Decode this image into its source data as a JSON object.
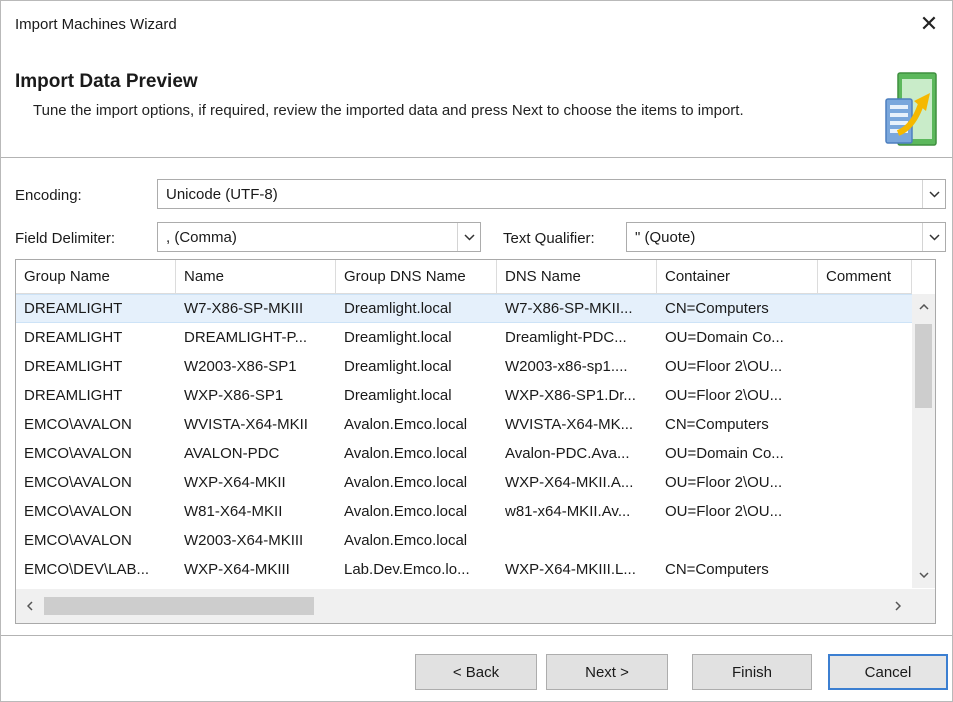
{
  "window": {
    "title": "Import Machines Wizard",
    "close_glyph": "✕"
  },
  "header": {
    "title": "Import Data Preview",
    "description": "Tune the import options, if required, review the imported data and press Next to choose the items to import.",
    "icon": "import-data-icon"
  },
  "encoding": {
    "label": "Encoding:",
    "value": "Unicode (UTF-8)"
  },
  "delimiter": {
    "label": "Field Delimiter:",
    "value": ", (Comma)"
  },
  "qualifier": {
    "label": "Text Qualifier:",
    "value": "\" (Quote)"
  },
  "grid": {
    "columns": [
      "Group Name",
      "Name",
      "Group DNS Name",
      "DNS Name",
      "Container",
      "Comment"
    ],
    "rows": [
      [
        "DREAMLIGHT",
        "W7-X86-SP-MKIII",
        "Dreamlight.local",
        "W7-X86-SP-MKII...",
        "CN=Computers",
        ""
      ],
      [
        "DREAMLIGHT",
        "DREAMLIGHT-P...",
        "Dreamlight.local",
        "Dreamlight-PDC...",
        "OU=Domain Co...",
        ""
      ],
      [
        "DREAMLIGHT",
        "W2003-X86-SP1",
        "Dreamlight.local",
        "W2003-x86-sp1....",
        "OU=Floor 2\\OU...",
        ""
      ],
      [
        "DREAMLIGHT",
        "WXP-X86-SP1",
        "Dreamlight.local",
        "WXP-X86-SP1.Dr...",
        "OU=Floor 2\\OU...",
        ""
      ],
      [
        "EMCO\\AVALON",
        "WVISTA-X64-MKII",
        "Avalon.Emco.local",
        "WVISTA-X64-MK...",
        "CN=Computers",
        ""
      ],
      [
        "EMCO\\AVALON",
        "AVALON-PDC",
        "Avalon.Emco.local",
        "Avalon-PDC.Ava...",
        "OU=Domain Co...",
        ""
      ],
      [
        "EMCO\\AVALON",
        "WXP-X64-MKII",
        "Avalon.Emco.local",
        "WXP-X64-MKII.A...",
        "OU=Floor 2\\OU...",
        ""
      ],
      [
        "EMCO\\AVALON",
        "W81-X64-MKII",
        "Avalon.Emco.local",
        "w81-x64-MKII.Av...",
        "OU=Floor 2\\OU...",
        ""
      ],
      [
        "EMCO\\AVALON",
        "W2003-X64-MKIII",
        "Avalon.Emco.local",
        "",
        "",
        ""
      ],
      [
        "EMCO\\DEV\\LAB...",
        "WXP-X64-MKIII",
        "Lab.Dev.Emco.lo...",
        "WXP-X64-MKIII.L...",
        "CN=Computers",
        ""
      ]
    ],
    "selected_row": 0
  },
  "buttons": {
    "back": "< Back",
    "next": "Next >",
    "finish": "Finish",
    "cancel": "Cancel"
  },
  "colors": {
    "selection": "#e5f0fb",
    "default_button_border": "#3c7fd1",
    "icon_green": "#5cb85c",
    "icon_blue": "#7aa7dc",
    "icon_arrow": "#f5b800"
  }
}
